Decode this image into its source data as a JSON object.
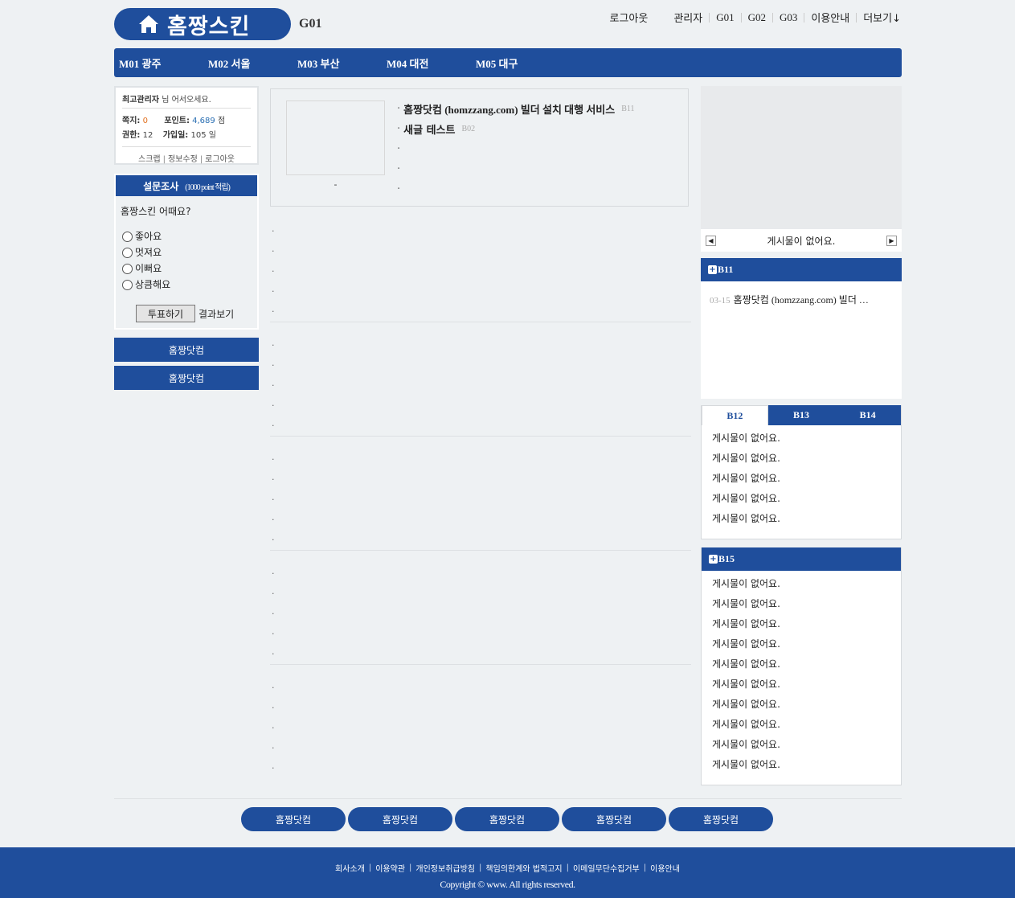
{
  "header": {
    "logo_text": "홈짱스킨",
    "site_code": "G01",
    "top_links": [
      "로그아웃",
      "관리자",
      "G01",
      "G02",
      "G03",
      "이용안내",
      "더보기↓"
    ]
  },
  "nav": [
    "M01 광주",
    "M02 서울",
    "M03 부산",
    "M04 대전",
    "M05 대구"
  ],
  "login": {
    "user": "최고관리자",
    "welcome_suffix": "님 어서오세요.",
    "memo_label": "쪽지:",
    "memo_value": "0",
    "point_label": "포인트:",
    "point_value": "4,689",
    "point_unit": "점",
    "level_label": "권한:",
    "level_value": "12",
    "join_label": "가입일:",
    "join_value": "105 일",
    "actions": [
      "스크랩",
      "정보수정",
      "로그아웃"
    ]
  },
  "poll": {
    "title": "설문조사",
    "subtitle": "(1000 point 적립)",
    "question": "홈짱스킨 어때요?",
    "options": [
      "좋아요",
      "멋져요",
      "이뻐요",
      "상큼해요"
    ],
    "vote_label": "투표하기",
    "result_label": "결과보기"
  },
  "left_buttons": [
    "홈짱닷컴",
    "홈짱닷컴"
  ],
  "feature": {
    "caption": "-",
    "items": [
      {
        "title": "홈짱닷컴 (homzzang.com) 빌더 설치 대행 서비스",
        "tag": "B11"
      },
      {
        "title": "새글 테스트",
        "tag": "B02"
      },
      {
        "title": "",
        "tag": ""
      },
      {
        "title": "",
        "tag": ""
      },
      {
        "title": "",
        "tag": ""
      }
    ]
  },
  "center_dot": "·",
  "right": {
    "slider_text": "게시물이 없어요.",
    "b11": {
      "title": "B11",
      "date": "03-15",
      "entry": "홈짱닷컴 (homzzang.com) 빌더 …"
    },
    "tabs": [
      "B12",
      "B13",
      "B14"
    ],
    "tab_items": [
      "게시물이 없어요.",
      "게시물이 없어요.",
      "게시물이 없어요.",
      "게시물이 없어요.",
      "게시물이 없어요."
    ],
    "b15": {
      "title": "B15",
      "items": [
        "게시물이 없어요.",
        "게시물이 없어요.",
        "게시물이 없어요.",
        "게시물이 없어요.",
        "게시물이 없어요.",
        "게시물이 없어요.",
        "게시물이 없어요.",
        "게시물이 없어요.",
        "게시물이 없어요.",
        "게시물이 없어요."
      ]
    }
  },
  "bottom_buttons": [
    "홈짱닷컴",
    "홈짱닷컴",
    "홈짱닷컴",
    "홈짱닷컴",
    "홈짱닷컴"
  ],
  "footer": {
    "links": [
      "회사소개",
      "이용약관",
      "개인정보취급방침",
      "책임의한계와 법적고지",
      "이메일무단수집거부",
      "이용안내"
    ],
    "copyright": "Copyright © www. All rights reserved."
  }
}
